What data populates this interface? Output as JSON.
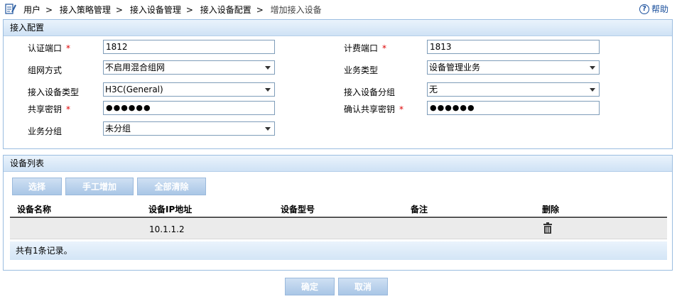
{
  "breadcrumb": {
    "items": [
      "用户",
      "接入策略管理",
      "接入设备管理",
      "接入设备配置",
      "增加接入设备"
    ],
    "separator": ">"
  },
  "help": {
    "label": "帮助",
    "icon": "help-circle-icon"
  },
  "access_config": {
    "title": "接入配置",
    "auth_port": {
      "label": "认证端口",
      "value": "1812"
    },
    "acct_port": {
      "label": "计费端口",
      "value": "1813"
    },
    "network_mode": {
      "label": "组网方式",
      "value": "不启用混合组网"
    },
    "service_type": {
      "label": "业务类型",
      "value": "设备管理业务"
    },
    "device_type": {
      "label": "接入设备类型",
      "value": "H3C(General)"
    },
    "device_group": {
      "label": "接入设备分组",
      "value": "无"
    },
    "shared_key": {
      "label": "共享密钥",
      "value": "●●●●●●"
    },
    "confirm_key": {
      "label": "确认共享密钥",
      "value": "●●●●●●"
    },
    "service_group": {
      "label": "业务分组",
      "value": "未分组"
    },
    "required_mark": "*"
  },
  "device_list": {
    "title": "设备列表",
    "buttons": {
      "select": "选择",
      "manual_add": "手工增加",
      "clear_all": "全部清除"
    },
    "columns": [
      "设备名称",
      "设备IP地址",
      "设备型号",
      "备注",
      "删除"
    ],
    "rows": [
      {
        "name": "",
        "ip": "10.1.1.2",
        "model": "",
        "remark": ""
      }
    ],
    "footer": "共有1条记录。"
  },
  "actions": {
    "ok": "确定",
    "cancel": "取消"
  },
  "colors": {
    "panel_border": "#9bbde0",
    "button_bg": "#b8d1ec",
    "help_blue": "#1a4f9c",
    "required": "#dd0000"
  }
}
